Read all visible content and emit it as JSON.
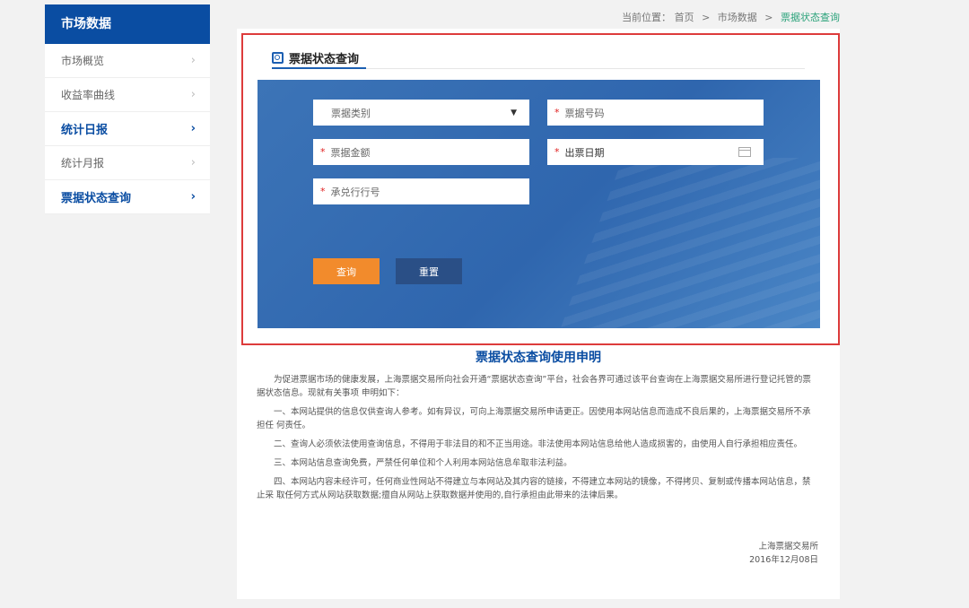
{
  "sidebar": {
    "header": "市场数据",
    "items": [
      {
        "label": "市场概览"
      },
      {
        "label": "收益率曲线"
      },
      {
        "label": "统计日报"
      },
      {
        "label": "统计月报"
      },
      {
        "label": "票据状态查询"
      }
    ]
  },
  "breadcrumb": {
    "prefix": "当前位置：",
    "home": "首页",
    "section": "市场数据",
    "current": "票据状态查询",
    "separator": ">"
  },
  "panel": {
    "title": "票据状态查询",
    "fields": {
      "type_select": "票据类别",
      "number": "票据号码",
      "amount": "票据金额",
      "date": "出票日期",
      "acceptor": "承兑行行号"
    },
    "required_mark": "*",
    "query_label": "查询",
    "reset_label": "重置"
  },
  "statement": {
    "title": "票据状态查询使用申明",
    "paragraphs": [
      "为促进票据市场的健康发展，上海票据交易所向社会开通“票据状态查询”平台，社会各界可通过该平台查询在上海票据交易所进行登记托管的票据状态信息。现就有关事项 申明如下：",
      "一、本网站提供的信息仅供查询人参考。如有异议，可向上海票据交易所申请更正。因使用本网站信息而造成不良后果的，上海票据交易所不承担任 何责任。",
      "二、查询人必须依法使用查询信息，不得用于非法目的和不正当用途。非法使用本网站信息给他人造成损害的，由使用人自行承担相应责任。",
      "三、本网站信息查询免费，严禁任何单位和个人利用本网站信息牟取非法利益。",
      "四、本网站内容未经许可，任何商业性网站不得建立与本网站及其内容的链接，不得建立本网站的镜像，不得拷贝、复制或传播本网站信息，禁止采 取任何方式从网站获取数据;擅自从网站上获取数据并使用的,自行承担由此带来的法律后果。"
    ],
    "signer": "上海票据交易所",
    "date": "2016年12月08日"
  },
  "colors": {
    "brand_blue": "#0a4da2",
    "panel_blue": "#3c74b7",
    "query_orange": "#f28b2c",
    "reset_navy": "#2a4f86",
    "highlight_red": "#dd3b3b",
    "breadcrumb_current": "#2aa27a"
  }
}
